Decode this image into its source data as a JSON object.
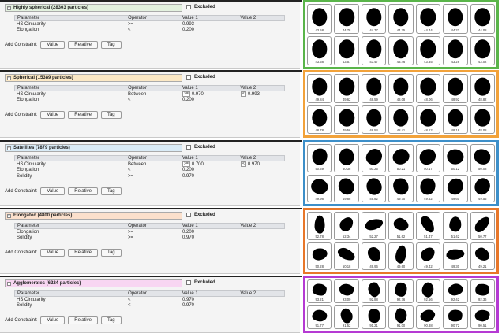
{
  "add_constraint_label": "Add Constraint:",
  "btn_value": "Value",
  "btn_relative": "Relative",
  "btn_tag": "Tag",
  "excluded_label": "Excluded",
  "columns": [
    "Parameter",
    "Operator",
    "Value 1",
    "Value 2"
  ],
  "classes": [
    {
      "title": "Highly spherical (28303 particles)",
      "color": "#e3f1df",
      "border": "#5ab54a",
      "rows": [
        {
          "param": "HS Circularity",
          "op": ">=",
          "v1": "0.993",
          "v2": ""
        },
        {
          "param": "Elongation",
          "op": "<",
          "v1": "0.200",
          "v2": ""
        }
      ],
      "labels": [
        "43.58",
        "44.78",
        "44.77",
        "44.75",
        "44.44",
        "44.21",
        "44.08",
        "43.58",
        "43.57",
        "43.47",
        "43.46",
        "43.35",
        "43.26",
        "43.02"
      ]
    },
    {
      "title": "Spherical (15389 particles)",
      "color": "#fbe8c5",
      "border": "#f2a23a",
      "rows": [
        {
          "param": "HS Circularity",
          "op": "Between",
          "v1": "0.970",
          "v1op": ">=",
          "v2": "0.993",
          "v2op": "<"
        },
        {
          "param": "Elongation",
          "op": "<",
          "v1": "0.200",
          "v2": ""
        }
      ],
      "labels": [
        "49.84",
        "49.62",
        "48.59",
        "48.08",
        "48.06",
        "48.92",
        "48.82",
        "48.78",
        "49.56",
        "48.54",
        "48.41",
        "48.12",
        "48.18",
        "48.08"
      ]
    },
    {
      "title": "Satellites (7879 particles)",
      "color": "#d9ebf6",
      "border": "#3d8fc9",
      "rows": [
        {
          "param": "HS Circularity",
          "op": "Between",
          "v1": "0.700",
          "v1op": ">=",
          "v2": "0.970",
          "v2op": "<"
        },
        {
          "param": "Elongation",
          "op": "<",
          "v1": "0.200",
          "v2": ""
        },
        {
          "param": "Solidity",
          "op": ">=",
          "v1": "0.970",
          "v2": ""
        }
      ],
      "labels": [
        "50.39",
        "50.38",
        "50.25",
        "50.21",
        "50.17",
        "50.12",
        "50.08",
        "49.98",
        "49.88",
        "49.82",
        "49.70",
        "49.62",
        "49.60",
        "49.55"
      ]
    },
    {
      "title": "Elongated (4800 particles)",
      "color": "#fbe0cc",
      "border": "#e8772a",
      "rows": [
        {
          "param": "Elongation",
          "op": ">=",
          "v1": "0.200",
          "v2": ""
        },
        {
          "param": "Solidity",
          "op": ">=",
          "v1": "0.970",
          "v2": ""
        }
      ],
      "labels": [
        "52.78",
        "52.34",
        "52.27",
        "51.62",
        "51.47",
        "51.42",
        "50.77",
        "50.28",
        "50.18",
        "49.96",
        "49.60",
        "49.42",
        "49.30",
        "49.21"
      ]
    },
    {
      "title": "Agglomerates (6224 particles)",
      "color": "#f8d6f2",
      "border": "#b53ad3",
      "rows": [
        {
          "param": "HS Circularity",
          "op": "<",
          "v1": "0.970",
          "v2": ""
        },
        {
          "param": "Solidity",
          "op": "<",
          "v1": "0.970",
          "v2": ""
        }
      ],
      "labels": [
        "93.21",
        "93.00",
        "92.88",
        "92.76",
        "92.56",
        "92.42",
        "92.36",
        "91.77",
        "91.52",
        "91.21",
        "91.00",
        "90.88",
        "90.72",
        "90.51"
      ]
    }
  ]
}
